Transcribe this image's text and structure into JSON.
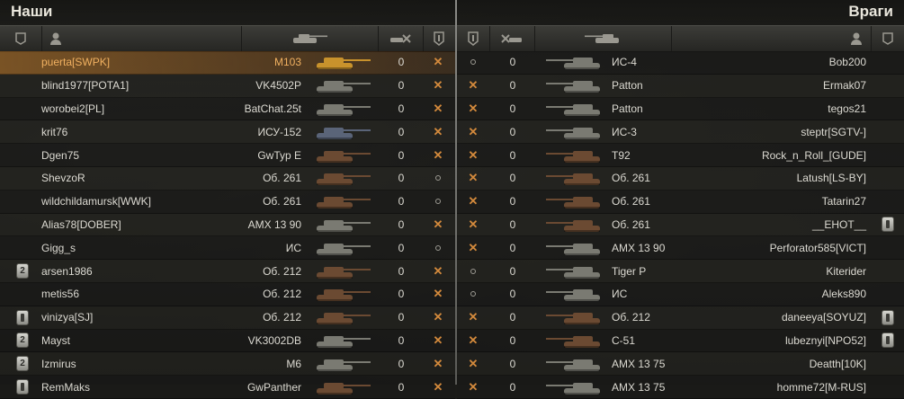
{
  "teams": {
    "left_title": "Наши",
    "right_title": "Враги"
  },
  "colors": {
    "highlight": "#c57a2e",
    "text": "#dcdad2",
    "player_highlight_text": "#f0b060",
    "destroyed": "#d48a3c",
    "tank_silhouette_gray": "#7a7a72",
    "tank_silhouette_brown": "#6b4a32",
    "tank_silhouette_blue": "#5a6478",
    "tank_silhouette_gold": "#c8922c"
  },
  "header_icons": [
    "badge-column-icon",
    "player-column-icon",
    "tank-column-icon",
    "frags-column-icon",
    "status-column-icon"
  ],
  "left_team": [
    {
      "badge": "",
      "name": "puerta[SWPK]",
      "tank": "M103",
      "frags": "0",
      "status": "destroyed",
      "tank_color": "gold",
      "highlight": true
    },
    {
      "badge": "",
      "name": "blind1977[POTA1]",
      "tank": "VK4502P",
      "frags": "0",
      "status": "destroyed",
      "tank_color": "gray"
    },
    {
      "badge": "",
      "name": "worobei2[PL]",
      "tank": "BatChat.25t",
      "frags": "0",
      "status": "destroyed",
      "tank_color": "gray"
    },
    {
      "badge": "",
      "name": "krit76",
      "tank": "ИСУ-152",
      "frags": "0",
      "status": "destroyed",
      "tank_color": "blue"
    },
    {
      "badge": "",
      "name": "Dgen75",
      "tank": "GwTyp E",
      "frags": "0",
      "status": "destroyed",
      "tank_color": "brown"
    },
    {
      "badge": "",
      "name": "ShevzoR",
      "tank": "Об. 261",
      "frags": "0",
      "status": "alive",
      "tank_color": "brown"
    },
    {
      "badge": "",
      "name": "wildchildamursk[WWK]",
      "tank": "Об. 261",
      "frags": "0",
      "status": "alive",
      "tank_color": "brown"
    },
    {
      "badge": "",
      "name": "Alias78[DOBER]",
      "tank": "AMX 13 90",
      "frags": "0",
      "status": "destroyed",
      "tank_color": "gray"
    },
    {
      "badge": "",
      "name": "Gigg_s",
      "tank": "ИС",
      "frags": "0",
      "status": "alive",
      "tank_color": "gray"
    },
    {
      "badge": "2",
      "name": "arsen1986",
      "tank": "Об. 212",
      "frags": "0",
      "status": "destroyed",
      "tank_color": "brown"
    },
    {
      "badge": "",
      "name": "metis56",
      "tank": "Об. 212",
      "frags": "0",
      "status": "destroyed",
      "tank_color": "brown"
    },
    {
      "badge": "plain",
      "name": "vinizya[SJ]",
      "tank": "Об. 212",
      "frags": "0",
      "status": "destroyed",
      "tank_color": "brown"
    },
    {
      "badge": "2",
      "name": "Mayst",
      "tank": "VK3002DB",
      "frags": "0",
      "status": "destroyed",
      "tank_color": "gray"
    },
    {
      "badge": "2",
      "name": "Izmirus",
      "tank": "M6",
      "frags": "0",
      "status": "destroyed",
      "tank_color": "gray"
    },
    {
      "badge": "plain",
      "name": "RemMaks",
      "tank": "GwPanther",
      "frags": "0",
      "status": "destroyed",
      "tank_color": "brown"
    }
  ],
  "right_team": [
    {
      "status": "alive",
      "frags": "0",
      "tank": "ИС-4",
      "name": "Bob200",
      "badge": "",
      "tank_color": "gray"
    },
    {
      "status": "destroyed",
      "frags": "0",
      "tank": "Patton",
      "name": "Ermak07",
      "badge": "",
      "tank_color": "gray"
    },
    {
      "status": "destroyed",
      "frags": "0",
      "tank": "Patton",
      "name": "tegos21",
      "badge": "",
      "tank_color": "gray"
    },
    {
      "status": "destroyed",
      "frags": "0",
      "tank": "ИС-3",
      "name": "steptr[SGTV-]",
      "badge": "",
      "tank_color": "gray"
    },
    {
      "status": "destroyed",
      "frags": "0",
      "tank": "T92",
      "name": "Rock_n_Roll_[GUDE]",
      "badge": "",
      "tank_color": "brown"
    },
    {
      "status": "destroyed",
      "frags": "0",
      "tank": "Об. 261",
      "name": "Latush[LS-BY]",
      "badge": "",
      "tank_color": "brown"
    },
    {
      "status": "destroyed",
      "frags": "0",
      "tank": "Об. 261",
      "name": "Tatarin27",
      "badge": "",
      "tank_color": "brown"
    },
    {
      "status": "destroyed",
      "frags": "0",
      "tank": "Об. 261",
      "name": "__EHOT__",
      "badge": "plain",
      "tank_color": "brown"
    },
    {
      "status": "destroyed",
      "frags": "0",
      "tank": "AMX 13 90",
      "name": "Perforator585[VICT]",
      "badge": "",
      "tank_color": "gray"
    },
    {
      "status": "alive",
      "frags": "0",
      "tank": "Tiger P",
      "name": "Kiterider",
      "badge": "",
      "tank_color": "gray"
    },
    {
      "status": "alive",
      "frags": "0",
      "tank": "ИС",
      "name": "Aleks890",
      "badge": "",
      "tank_color": "gray"
    },
    {
      "status": "destroyed",
      "frags": "0",
      "tank": "Об. 212",
      "name": "daneeya[SOYUZ]",
      "badge": "plain",
      "tank_color": "brown"
    },
    {
      "status": "destroyed",
      "frags": "0",
      "tank": "C-51",
      "name": "lubeznyi[NPO52]",
      "badge": "plain",
      "tank_color": "brown"
    },
    {
      "status": "destroyed",
      "frags": "0",
      "tank": "AMX 13 75",
      "name": "Deatth[10K]",
      "badge": "",
      "tank_color": "gray"
    },
    {
      "status": "destroyed",
      "frags": "0",
      "tank": "AMX 13 75",
      "name": "homme72[M-RUS]",
      "badge": "",
      "tank_color": "gray"
    }
  ]
}
